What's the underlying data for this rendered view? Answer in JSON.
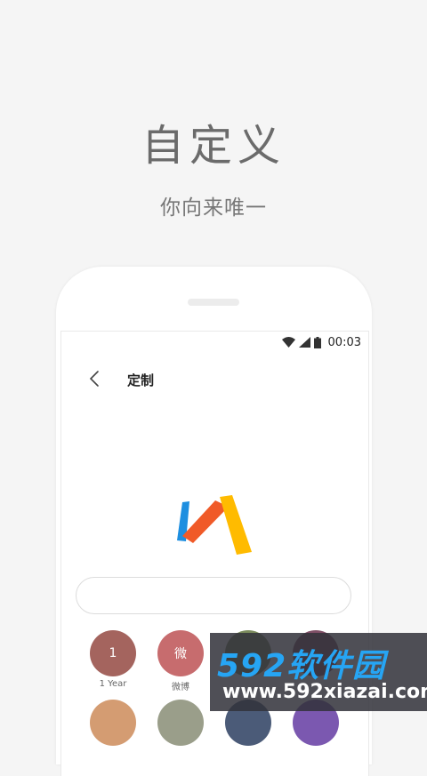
{
  "hero": {
    "title": "自定义",
    "subtitle": "你向来唯一"
  },
  "phone": {
    "status_bar": {
      "time": "00:03",
      "icons": [
        "wifi-icon",
        "cellular-signal-icon",
        "battery-icon"
      ]
    },
    "toolbar": {
      "back_icon": "chevron-left-icon",
      "title": "定制"
    },
    "logo": "via-browser-logo",
    "input": {
      "value": ""
    },
    "color_swatches": [
      {
        "glyph": "1",
        "label": "1 Year",
        "color": "#a4645e"
      },
      {
        "glyph": "微",
        "label": "微博",
        "color": "#c76c6e"
      },
      {
        "glyph": "",
        "label": "",
        "color": "#7a8a5c"
      },
      {
        "glyph": "",
        "label": "",
        "color": "#7f4f66"
      },
      {
        "glyph": "",
        "label": "",
        "color": "#d49c72"
      },
      {
        "glyph": "",
        "label": "",
        "color": "#9a9e8a"
      },
      {
        "glyph": "",
        "label": "",
        "color": "#4b5b78"
      },
      {
        "glyph": "",
        "label": "",
        "color": "#7b58b0"
      }
    ]
  },
  "watermark": {
    "brand": "592软件园",
    "url": "www.592xiazai.com"
  }
}
